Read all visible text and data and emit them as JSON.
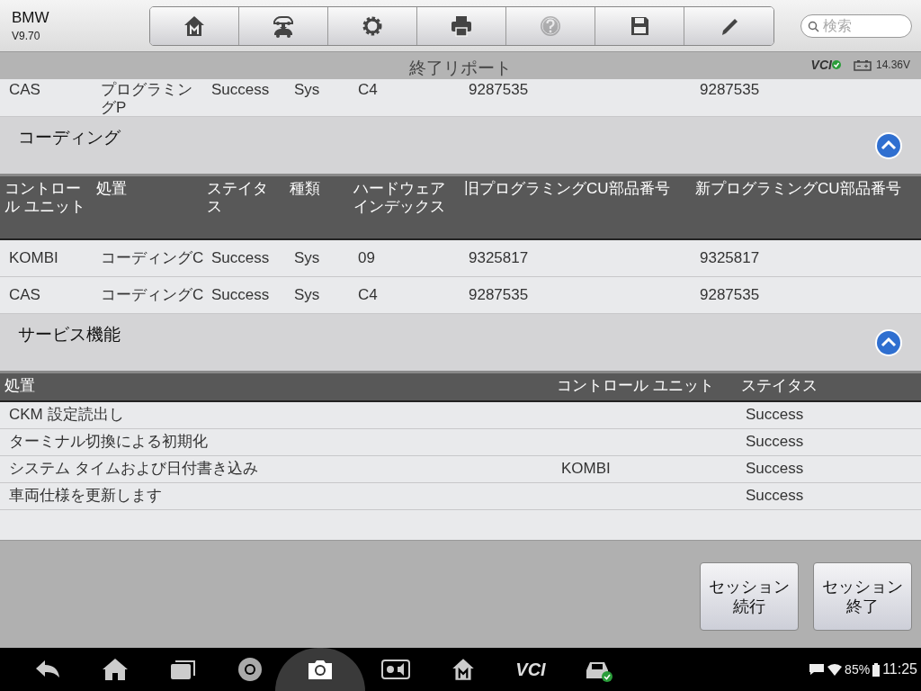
{
  "app": {
    "name": "BMW",
    "version": "V9.70"
  },
  "toolbar": [
    {
      "kind": "home",
      "disabled": false
    },
    {
      "kind": "transfer",
      "disabled": false
    },
    {
      "kind": "settings",
      "disabled": false
    },
    {
      "kind": "print",
      "disabled": false
    },
    {
      "kind": "help",
      "disabled": true
    },
    {
      "kind": "save",
      "disabled": false
    },
    {
      "kind": "edit",
      "disabled": false
    }
  ],
  "search": {
    "placeholder": "検索"
  },
  "title": "終了リポート",
  "status": {
    "vci": "VCI",
    "vci_connected": true,
    "voltage": "14.36V"
  },
  "top_rows": [
    [
      "CAS",
      "プログラミングP",
      "Success",
      "Sys",
      "C4",
      "9287535",
      "9287535"
    ]
  ],
  "sections": [
    {
      "kind": "wide",
      "title": "コーディング",
      "expanded": true,
      "columns": [
        "コントロール ユニット",
        "処置",
        "ステイタス",
        "種類",
        "ハードウェアインデックス",
        "旧プログラミングCU部品番号",
        "新プログラミングCU部品番号"
      ],
      "rows": [
        [
          "KOMBI",
          "コーディングC",
          "Success",
          "Sys",
          "09",
          "9325817",
          "9325817"
        ],
        [
          "CAS",
          "コーディングC",
          "Success",
          "Sys",
          "C4",
          "9287535",
          "9287535"
        ]
      ]
    },
    {
      "kind": "narrow",
      "title": "サービス機能",
      "expanded": true,
      "columns": [
        "処置",
        "コントロール ユニット",
        "ステイタス"
      ],
      "rows": [
        [
          "CKM 設定読出し",
          "",
          "Success"
        ],
        [
          "ターミナル切換による初期化",
          "",
          "Success"
        ],
        [
          "システム タイムおよび日付書き込み",
          "KOMBI",
          "Success"
        ],
        [
          "車両仕様を更新します",
          "",
          "Success"
        ]
      ]
    }
  ],
  "buttons": [
    "セッション続行",
    "セッション終了"
  ],
  "taskbar": {
    "vci": "VCI",
    "battery": "85%",
    "time": "11:25"
  }
}
